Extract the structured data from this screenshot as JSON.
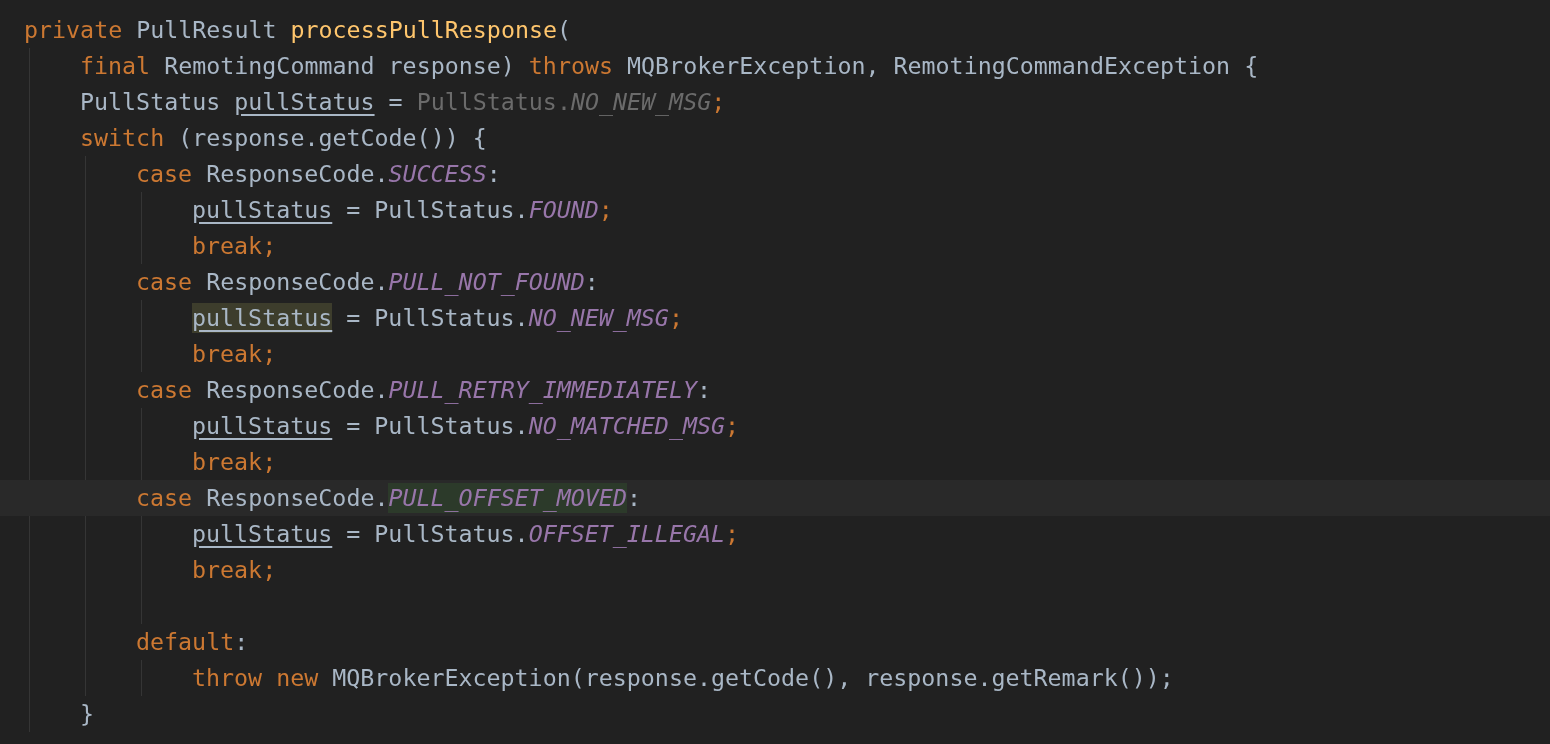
{
  "editor": {
    "lines": [
      {
        "current": false,
        "tokens": [
          {
            "text": "private",
            "kind": "keyword",
            "highlighted": false
          },
          {
            "text": " PullResult ",
            "kind": "plain",
            "highlighted": false
          },
          {
            "text": "processPullResponse",
            "kind": "method",
            "highlighted": false
          },
          {
            "text": "(",
            "kind": "plain",
            "highlighted": false
          }
        ],
        "children": [
          {
            "current": false,
            "tokens": [
              {
                "text": "final",
                "kind": "keyword",
                "highlighted": false
              },
              {
                "text": " RemotingCommand response) ",
                "kind": "plain",
                "highlighted": false
              },
              {
                "text": "throws",
                "kind": "keyword",
                "highlighted": false
              },
              {
                "text": " MQBrokerException, RemotingCommandException {",
                "kind": "plain",
                "highlighted": false
              }
            ]
          },
          {
            "current": false,
            "tokens": [
              {
                "text": "PullStatus ",
                "kind": "plain",
                "highlighted": false
              },
              {
                "text": "pullStatus",
                "kind": "variable",
                "highlighted": false
              },
              {
                "text": " = ",
                "kind": "plain",
                "highlighted": false
              },
              {
                "text": "PullStatus.",
                "kind": "unused",
                "highlighted": false
              },
              {
                "text": "NO_NEW_MSG",
                "kind": "unused-constant",
                "highlighted": false
              },
              {
                "text": ";",
                "kind": "keyword",
                "highlighted": false
              }
            ]
          },
          {
            "current": false,
            "tokens": [
              {
                "text": "switch",
                "kind": "keyword",
                "highlighted": false
              },
              {
                "text": " (response.getCode()) {",
                "kind": "plain",
                "highlighted": false
              }
            ],
            "children": [
              {
                "current": false,
                "tokens": [
                  {
                    "text": "case",
                    "kind": "keyword",
                    "highlighted": false
                  },
                  {
                    "text": " ResponseCode.",
                    "kind": "plain",
                    "highlighted": false
                  },
                  {
                    "text": "SUCCESS",
                    "kind": "constant",
                    "highlighted": false
                  },
                  {
                    "text": ":",
                    "kind": "plain",
                    "highlighted": false
                  }
                ],
                "children": [
                  {
                    "current": false,
                    "tokens": [
                      {
                        "text": "pullStatus",
                        "kind": "variable",
                        "highlighted": false
                      },
                      {
                        "text": " = PullStatus.",
                        "kind": "plain",
                        "highlighted": false
                      },
                      {
                        "text": "FOUND",
                        "kind": "constant",
                        "highlighted": false
                      },
                      {
                        "text": ";",
                        "kind": "keyword",
                        "highlighted": false
                      }
                    ]
                  },
                  {
                    "current": false,
                    "tokens": [
                      {
                        "text": "break;",
                        "kind": "keyword",
                        "highlighted": false
                      }
                    ]
                  }
                ]
              },
              {
                "current": false,
                "tokens": [
                  {
                    "text": "case",
                    "kind": "keyword",
                    "highlighted": false
                  },
                  {
                    "text": " ResponseCode.",
                    "kind": "plain",
                    "highlighted": false
                  },
                  {
                    "text": "PULL_NOT_FOUND",
                    "kind": "constant",
                    "highlighted": false
                  },
                  {
                    "text": ":",
                    "kind": "plain",
                    "highlighted": false
                  }
                ],
                "children": [
                  {
                    "current": false,
                    "tokens": [
                      {
                        "text": "pullStatus",
                        "kind": "variable",
                        "highlighted": true
                      },
                      {
                        "text": " = PullStatus.",
                        "kind": "plain",
                        "highlighted": false
                      },
                      {
                        "text": "NO_NEW_MSG",
                        "kind": "constant",
                        "highlighted": false
                      },
                      {
                        "text": ";",
                        "kind": "keyword",
                        "highlighted": false
                      }
                    ]
                  },
                  {
                    "current": false,
                    "tokens": [
                      {
                        "text": "break;",
                        "kind": "keyword",
                        "highlighted": false
                      }
                    ]
                  }
                ]
              },
              {
                "current": false,
                "tokens": [
                  {
                    "text": "case",
                    "kind": "keyword",
                    "highlighted": false
                  },
                  {
                    "text": " ResponseCode.",
                    "kind": "plain",
                    "highlighted": false
                  },
                  {
                    "text": "PULL_RETRY_IMMEDIATELY",
                    "kind": "constant",
                    "highlighted": false
                  },
                  {
                    "text": ":",
                    "kind": "plain",
                    "highlighted": false
                  }
                ],
                "children": [
                  {
                    "current": false,
                    "tokens": [
                      {
                        "text": "pullStatus",
                        "kind": "variable",
                        "highlighted": false
                      },
                      {
                        "text": " = PullStatus.",
                        "kind": "plain",
                        "highlighted": false
                      },
                      {
                        "text": "NO_MATCHED_MSG",
                        "kind": "constant",
                        "highlighted": false
                      },
                      {
                        "text": ";",
                        "kind": "keyword",
                        "highlighted": false
                      }
                    ]
                  },
                  {
                    "current": false,
                    "tokens": [
                      {
                        "text": "break;",
                        "kind": "keyword",
                        "highlighted": false
                      }
                    ]
                  }
                ]
              },
              {
                "current": true,
                "tokens": [
                  {
                    "text": "case",
                    "kind": "keyword",
                    "highlighted": false
                  },
                  {
                    "text": " ResponseCode.",
                    "kind": "plain",
                    "highlighted": false
                  },
                  {
                    "text": "PULL_OFFSET_MOVED",
                    "kind": "constant",
                    "highlighted": true
                  },
                  {
                    "text": ":",
                    "kind": "plain",
                    "highlighted": false
                  }
                ],
                "children": [
                  {
                    "current": false,
                    "tokens": [
                      {
                        "text": "pullStatus",
                        "kind": "variable",
                        "highlighted": false
                      },
                      {
                        "text": " = PullStatus.",
                        "kind": "plain",
                        "highlighted": false
                      },
                      {
                        "text": "OFFSET_ILLEGAL",
                        "kind": "constant",
                        "highlighted": false
                      },
                      {
                        "text": ";",
                        "kind": "keyword",
                        "highlighted": false
                      }
                    ]
                  },
                  {
                    "current": false,
                    "tokens": [
                      {
                        "text": "break;",
                        "kind": "keyword",
                        "highlighted": false
                      }
                    ]
                  },
                  {
                    "current": false
                  }
                ]
              },
              {
                "current": false,
                "tokens": [
                  {
                    "text": "default",
                    "kind": "keyword",
                    "highlighted": false
                  },
                  {
                    "text": ":",
                    "kind": "plain",
                    "highlighted": false
                  }
                ],
                "children": [
                  {
                    "current": false,
                    "tokens": [
                      {
                        "text": "throw new",
                        "kind": "keyword",
                        "highlighted": false
                      },
                      {
                        "text": " MQBrokerException(response.getCode(), response.getRemark());",
                        "kind": "plain",
                        "highlighted": false
                      }
                    ]
                  }
                ]
              }
            ]
          },
          {
            "current": false,
            "tokens": [
              {
                "text": "}",
                "kind": "plain",
                "highlighted": false
              }
            ]
          }
        ]
      }
    ]
  }
}
